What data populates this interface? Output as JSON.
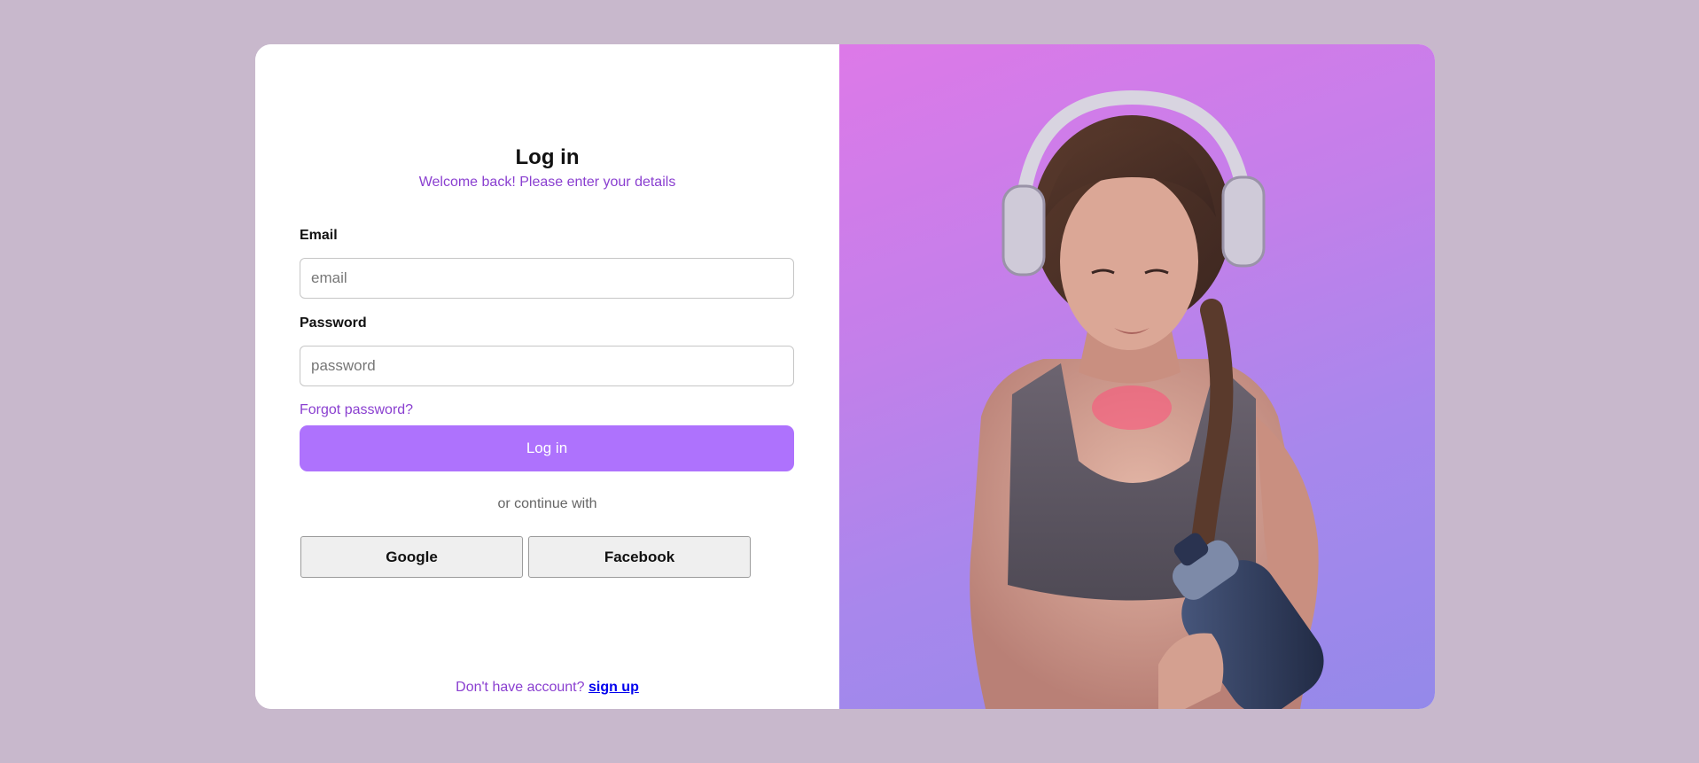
{
  "login": {
    "title": "Log in",
    "subtitle": "Welcome back! Please enter your details",
    "email_label": "Email",
    "email_placeholder": "email",
    "email_value": "",
    "password_label": "Password",
    "password_placeholder": "password",
    "password_value": "",
    "forgot_link": "Forgot password?",
    "submit_label": "Log in",
    "divider_text": "or continue with",
    "google_label": "Google",
    "facebook_label": "Facebook",
    "footer_text": "Don't have account?",
    "signup_link": "sign up"
  },
  "hero": {
    "image_icon": "fitness-woman-photo"
  },
  "colors": {
    "page_background": "#c8b8cc",
    "accent": "#ae72fd",
    "accent_text": "#8a3fd0",
    "link": "#0000ee"
  }
}
